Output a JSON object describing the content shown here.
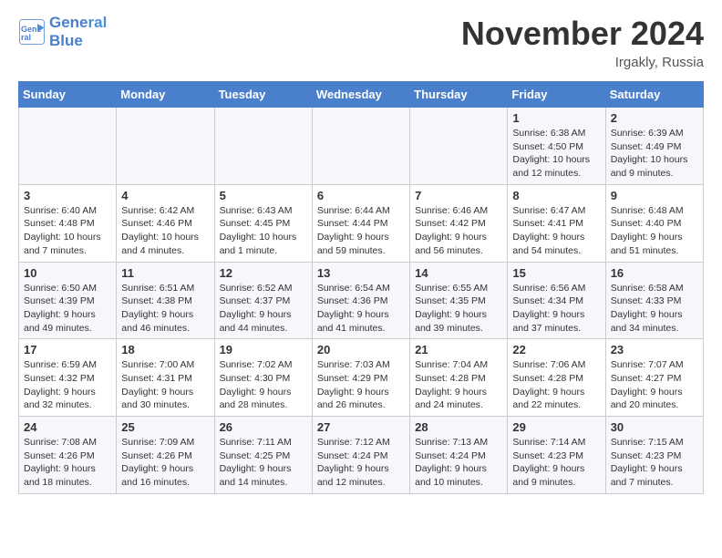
{
  "header": {
    "logo_line1": "General",
    "logo_line2": "Blue",
    "month_title": "November 2024",
    "location": "Irgakly, Russia"
  },
  "weekdays": [
    "Sunday",
    "Monday",
    "Tuesday",
    "Wednesday",
    "Thursday",
    "Friday",
    "Saturday"
  ],
  "weeks": [
    [
      {
        "day": "",
        "info": ""
      },
      {
        "day": "",
        "info": ""
      },
      {
        "day": "",
        "info": ""
      },
      {
        "day": "",
        "info": ""
      },
      {
        "day": "",
        "info": ""
      },
      {
        "day": "1",
        "info": "Sunrise: 6:38 AM\nSunset: 4:50 PM\nDaylight: 10 hours and 12 minutes."
      },
      {
        "day": "2",
        "info": "Sunrise: 6:39 AM\nSunset: 4:49 PM\nDaylight: 10 hours and 9 minutes."
      }
    ],
    [
      {
        "day": "3",
        "info": "Sunrise: 6:40 AM\nSunset: 4:48 PM\nDaylight: 10 hours and 7 minutes."
      },
      {
        "day": "4",
        "info": "Sunrise: 6:42 AM\nSunset: 4:46 PM\nDaylight: 10 hours and 4 minutes."
      },
      {
        "day": "5",
        "info": "Sunrise: 6:43 AM\nSunset: 4:45 PM\nDaylight: 10 hours and 1 minute."
      },
      {
        "day": "6",
        "info": "Sunrise: 6:44 AM\nSunset: 4:44 PM\nDaylight: 9 hours and 59 minutes."
      },
      {
        "day": "7",
        "info": "Sunrise: 6:46 AM\nSunset: 4:42 PM\nDaylight: 9 hours and 56 minutes."
      },
      {
        "day": "8",
        "info": "Sunrise: 6:47 AM\nSunset: 4:41 PM\nDaylight: 9 hours and 54 minutes."
      },
      {
        "day": "9",
        "info": "Sunrise: 6:48 AM\nSunset: 4:40 PM\nDaylight: 9 hours and 51 minutes."
      }
    ],
    [
      {
        "day": "10",
        "info": "Sunrise: 6:50 AM\nSunset: 4:39 PM\nDaylight: 9 hours and 49 minutes."
      },
      {
        "day": "11",
        "info": "Sunrise: 6:51 AM\nSunset: 4:38 PM\nDaylight: 9 hours and 46 minutes."
      },
      {
        "day": "12",
        "info": "Sunrise: 6:52 AM\nSunset: 4:37 PM\nDaylight: 9 hours and 44 minutes."
      },
      {
        "day": "13",
        "info": "Sunrise: 6:54 AM\nSunset: 4:36 PM\nDaylight: 9 hours and 41 minutes."
      },
      {
        "day": "14",
        "info": "Sunrise: 6:55 AM\nSunset: 4:35 PM\nDaylight: 9 hours and 39 minutes."
      },
      {
        "day": "15",
        "info": "Sunrise: 6:56 AM\nSunset: 4:34 PM\nDaylight: 9 hours and 37 minutes."
      },
      {
        "day": "16",
        "info": "Sunrise: 6:58 AM\nSunset: 4:33 PM\nDaylight: 9 hours and 34 minutes."
      }
    ],
    [
      {
        "day": "17",
        "info": "Sunrise: 6:59 AM\nSunset: 4:32 PM\nDaylight: 9 hours and 32 minutes."
      },
      {
        "day": "18",
        "info": "Sunrise: 7:00 AM\nSunset: 4:31 PM\nDaylight: 9 hours and 30 minutes."
      },
      {
        "day": "19",
        "info": "Sunrise: 7:02 AM\nSunset: 4:30 PM\nDaylight: 9 hours and 28 minutes."
      },
      {
        "day": "20",
        "info": "Sunrise: 7:03 AM\nSunset: 4:29 PM\nDaylight: 9 hours and 26 minutes."
      },
      {
        "day": "21",
        "info": "Sunrise: 7:04 AM\nSunset: 4:28 PM\nDaylight: 9 hours and 24 minutes."
      },
      {
        "day": "22",
        "info": "Sunrise: 7:06 AM\nSunset: 4:28 PM\nDaylight: 9 hours and 22 minutes."
      },
      {
        "day": "23",
        "info": "Sunrise: 7:07 AM\nSunset: 4:27 PM\nDaylight: 9 hours and 20 minutes."
      }
    ],
    [
      {
        "day": "24",
        "info": "Sunrise: 7:08 AM\nSunset: 4:26 PM\nDaylight: 9 hours and 18 minutes."
      },
      {
        "day": "25",
        "info": "Sunrise: 7:09 AM\nSunset: 4:26 PM\nDaylight: 9 hours and 16 minutes."
      },
      {
        "day": "26",
        "info": "Sunrise: 7:11 AM\nSunset: 4:25 PM\nDaylight: 9 hours and 14 minutes."
      },
      {
        "day": "27",
        "info": "Sunrise: 7:12 AM\nSunset: 4:24 PM\nDaylight: 9 hours and 12 minutes."
      },
      {
        "day": "28",
        "info": "Sunrise: 7:13 AM\nSunset: 4:24 PM\nDaylight: 9 hours and 10 minutes."
      },
      {
        "day": "29",
        "info": "Sunrise: 7:14 AM\nSunset: 4:23 PM\nDaylight: 9 hours and 9 minutes."
      },
      {
        "day": "30",
        "info": "Sunrise: 7:15 AM\nSunset: 4:23 PM\nDaylight: 9 hours and 7 minutes."
      }
    ]
  ]
}
